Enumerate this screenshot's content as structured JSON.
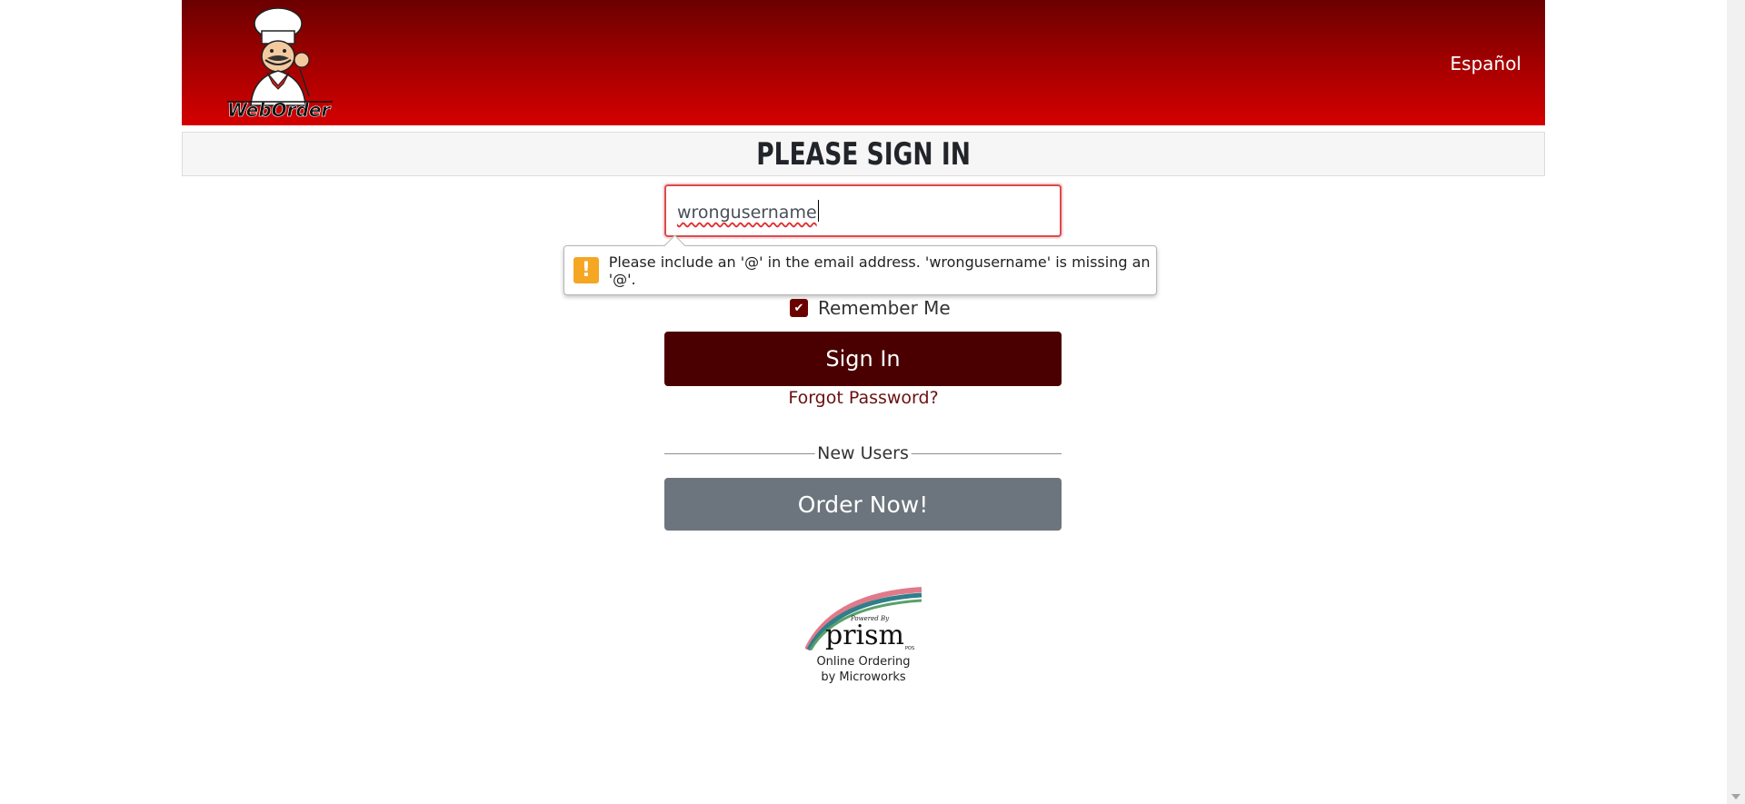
{
  "header": {
    "logo_text": "WebOrder",
    "language_link": "Español"
  },
  "title": "Please Sign In",
  "form": {
    "email_value": "wrongusername",
    "remember_label": "Remember Me",
    "remember_checked": true,
    "signin_label": "Sign In",
    "forgot_label": "Forgot Password?",
    "new_users_label": "New Users",
    "order_label": "Order Now!"
  },
  "validation_tooltip": {
    "icon": "warning-icon",
    "message": "Please include an '@' in the email address. 'wrongusername' is missing an '@'."
  },
  "footer": {
    "powered_by": "Powered By",
    "brand": "prism",
    "brand_suffix": "POS",
    "line1": "Online Ordering",
    "line2": "by Microworks"
  },
  "colors": {
    "header_top": "#6b0000",
    "header_bottom": "#d40000",
    "signin_button": "#4a0000",
    "order_button": "#6c757d",
    "warning": "#f5a623"
  }
}
